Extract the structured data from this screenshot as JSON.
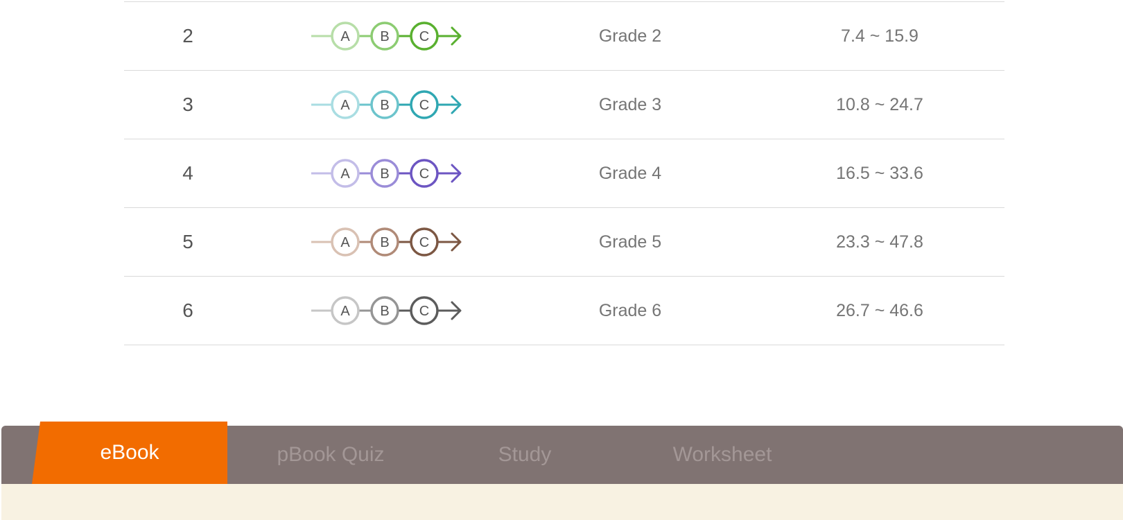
{
  "levels": [
    {
      "level": "2",
      "grade": "Grade 2",
      "range": "7.4 ~ 15.9",
      "colors": {
        "light": "#b7dea8",
        "mid": "#8ccc72",
        "dark": "#59b02f"
      }
    },
    {
      "level": "3",
      "grade": "Grade 3",
      "range": "10.8 ~ 24.7",
      "colors": {
        "light": "#a9dde2",
        "mid": "#6cc4cc",
        "dark": "#2fa7b2"
      }
    },
    {
      "level": "4",
      "grade": "Grade 4",
      "range": "16.5 ~ 33.6",
      "colors": {
        "light": "#c3bde8",
        "mid": "#9a8cd8",
        "dark": "#6c55c2"
      }
    },
    {
      "level": "5",
      "grade": "Grade 5",
      "range": "23.3 ~ 47.8",
      "colors": {
        "light": "#d9c1b3",
        "mid": "#b08a77",
        "dark": "#7c5743"
      }
    },
    {
      "level": "6",
      "grade": "Grade 6",
      "range": "26.7 ~ 46.6",
      "colors": {
        "light": "#c6c6c6",
        "mid": "#959595",
        "dark": "#5c5c5c"
      }
    }
  ],
  "step_letters": [
    "A",
    "B",
    "C"
  ],
  "tabs": {
    "ebook": "eBook",
    "pbook_quiz": "pBook Quiz",
    "study": "Study",
    "worksheet": "Worksheet",
    "active": "eBook"
  },
  "colors": {
    "tabbar": "#807372",
    "active_tab": "#f26c00",
    "inactive_tab_text": "#a39796",
    "panel": "#f8f2e2"
  }
}
